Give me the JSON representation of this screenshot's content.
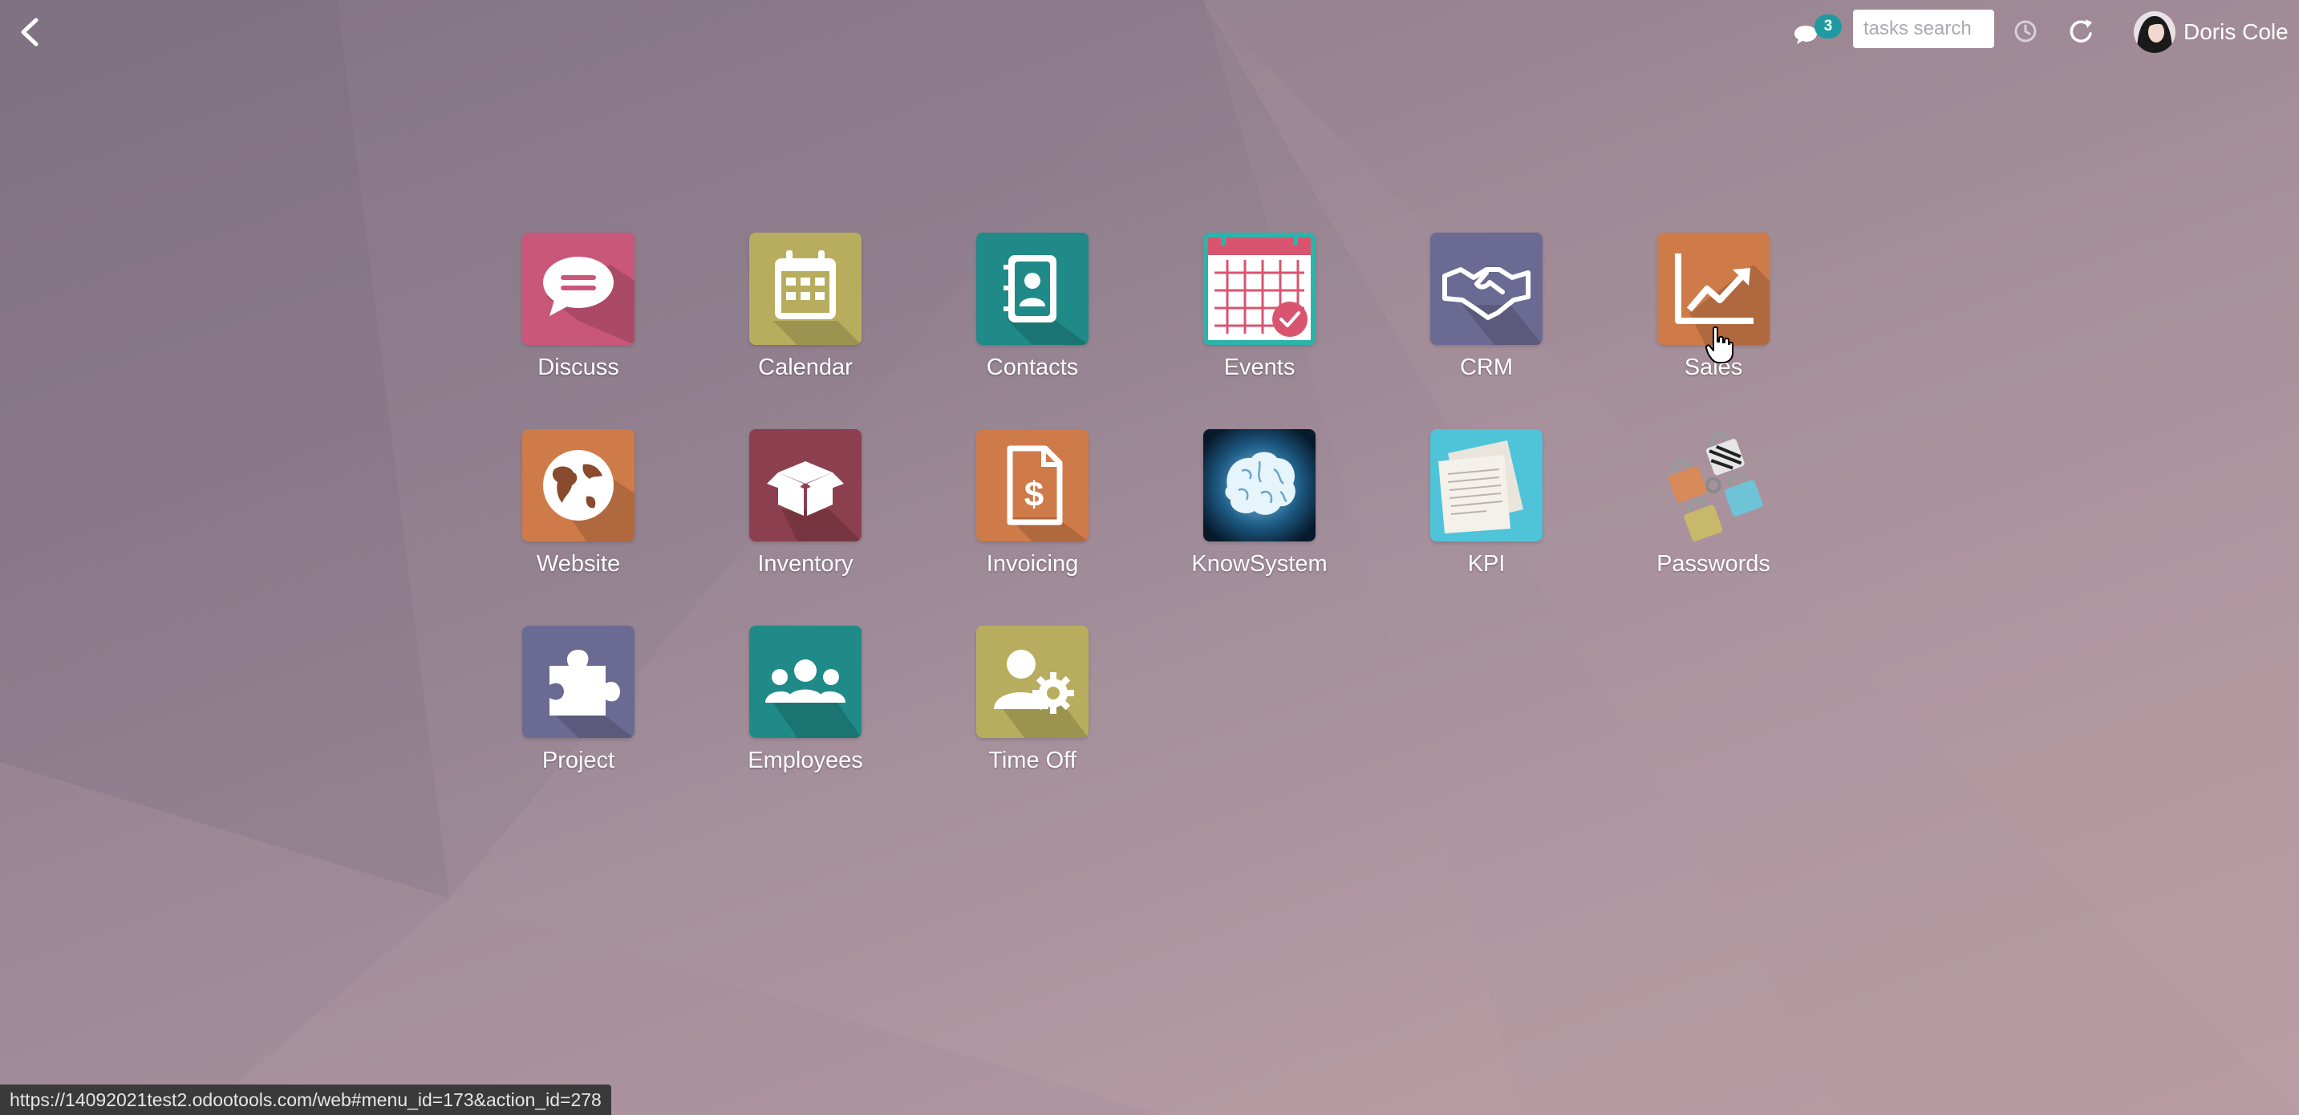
{
  "header": {
    "back_label": "back",
    "chat_count": "3",
    "search_placeholder": "tasks search",
    "user_name": "Doris Cole"
  },
  "apps": [
    {
      "name": "Discuss",
      "color": "#c9577a"
    },
    {
      "name": "Calendar",
      "color": "#b8ad5e"
    },
    {
      "name": "Contacts",
      "color": "#1f8a87"
    },
    {
      "name": "Events",
      "color": "#2ab4aa"
    },
    {
      "name": "CRM",
      "color": "#6b6a92"
    },
    {
      "name": "Sales",
      "color": "#cf7b49"
    },
    {
      "name": "Website",
      "color": "#cf7b49"
    },
    {
      "name": "Inventory",
      "color": "#8c3f4e"
    },
    {
      "name": "Invoicing",
      "color": "#cf7b49"
    },
    {
      "name": "KnowSystem",
      "color": "#0b2a45"
    },
    {
      "name": "KPI",
      "color": "#4fc3d8"
    },
    {
      "name": "Passwords",
      "color": "#a0a0a0"
    },
    {
      "name": "Project",
      "color": "#6b6a92"
    },
    {
      "name": "Employees",
      "color": "#1f8a87"
    },
    {
      "name": "Time Off",
      "color": "#b8ad5e"
    }
  ],
  "status_bar": {
    "url": "https://14092021test2.odootools.com/web#menu_id=173&action_id=278"
  }
}
